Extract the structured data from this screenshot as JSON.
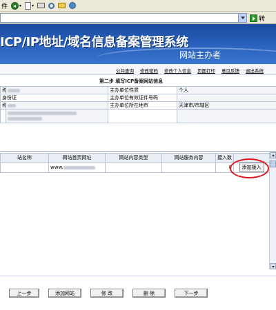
{
  "browser": {
    "toolbar": {
      "items": [
        {
          "type": "text",
          "label": "件"
        },
        {
          "type": "icon",
          "icon": "back-icon",
          "arrow": "▾"
        },
        {
          "type": "icon",
          "icon": "page-icon",
          "arrow": "▾"
        },
        {
          "type": "icon",
          "icon": "print-icon"
        },
        {
          "type": "icon",
          "icon": "search-icon"
        },
        {
          "type": "icon",
          "icon": "folder-icon"
        },
        {
          "type": "icon",
          "icon": "globe-icon"
        }
      ]
    },
    "address": {
      "value": "",
      "go_label": "转"
    }
  },
  "banner": {
    "title": "ICP/IP地址/域名信息备案管理系统",
    "subtitle": "网站主办者"
  },
  "nav": {
    "links": [
      "公共查询",
      "修改密码",
      "修改个人信息",
      "页面打印",
      "意见反馈",
      "退出系统"
    ]
  },
  "step_title": "第二步 填写ICP备案网站信息",
  "info": {
    "rows": [
      {
        "l1": "称",
        "v1_blur": 18,
        "l2": "主办单位性质",
        "v2": "个人"
      },
      {
        "l1": "身份证",
        "v1_blur": 0,
        "l2": "主办单位有效证件号码",
        "v2": ""
      },
      {
        "l1": "称",
        "v1_blur": 12,
        "l2": "主办单位所在地市",
        "v2": "天津市/市辖区"
      },
      {
        "l1": "",
        "v1_blur": 100,
        "l2": "",
        "v2": ""
      }
    ]
  },
  "sites": {
    "headers": [
      "站名称",
      "网站首页网址",
      "网站内容类型",
      "网站服务内容",
      "接入数",
      ""
    ],
    "rows": [
      {
        "name": "",
        "url_prefix": "www.",
        "content_type": "",
        "service": "",
        "access_count": "0",
        "action": "添加接入"
      }
    ]
  },
  "footer": {
    "buttons": [
      "上一步",
      "添加网站",
      "修  改",
      "删  除",
      "下一步"
    ]
  },
  "colors": {
    "banner": "#2b63bf",
    "highlight": "#e0161e"
  }
}
